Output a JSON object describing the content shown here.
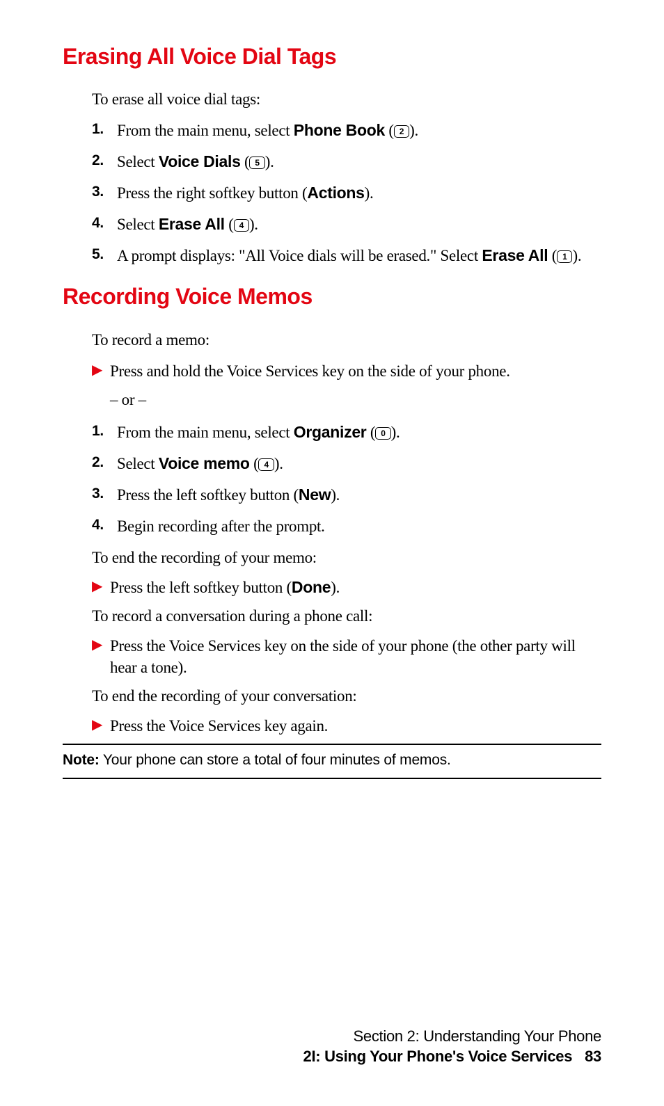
{
  "section1": {
    "heading": "Erasing All Voice Dial Tags",
    "intro": "To erase all voice dial tags:",
    "steps": [
      {
        "num": "1.",
        "pre": "From the main menu, select ",
        "bold": "Phone Book",
        "post_open": " (",
        "key": "2",
        "post_close": ")."
      },
      {
        "num": "2.",
        "pre": "Select ",
        "bold": "Voice Dials",
        "post_open": " (",
        "key": "5",
        "post_close": ")."
      },
      {
        "num": "3.",
        "pre": "Press the right softkey button (",
        "bold": "Actions",
        "post": ")."
      },
      {
        "num": "4.",
        "pre": "Select ",
        "bold": "Erase All",
        "post_open": " (",
        "key": "4",
        "post_close": ")."
      },
      {
        "num": "5.",
        "pre": "A prompt displays: \"All Voice dials will be erased.\" Select ",
        "bold": "Erase All",
        "post_open": " (",
        "key": "1",
        "post_close": ")."
      }
    ]
  },
  "section2": {
    "heading": "Recording Voice Memos",
    "intro": "To record a memo:",
    "bullet1": "Press and hold the Voice Services key on the side of your phone.",
    "ordash": "– or –",
    "steps": [
      {
        "num": "1.",
        "pre": "From the main menu, select ",
        "bold": "Organizer",
        "post_open": " (",
        "key": "0",
        "post_close": ")."
      },
      {
        "num": "2.",
        "pre": "Select ",
        "bold": "Voice memo",
        "post_open": " (",
        "key": "4",
        "post_close": ")."
      },
      {
        "num": "3.",
        "pre": "Press the left softkey button (",
        "bold": "New",
        "post": ")."
      },
      {
        "num": "4.",
        "pre": "Begin recording after the prompt."
      }
    ],
    "para_end_memo": "To end the recording of your memo:",
    "bullet_done_pre": "Press the left softkey button (",
    "bullet_done_bold": "Done",
    "bullet_done_post": ").",
    "para_record_conv": "To record a conversation during a phone call:",
    "bullet_conv": "Press the Voice Services key on the side of your phone (the other party will hear a tone).",
    "para_end_conv": "To end the recording of your conversation:",
    "bullet_again": "Press the Voice Services key again."
  },
  "note": {
    "label": "Note:",
    "text": " Your phone can store a total of four minutes of memos."
  },
  "footer": {
    "line1": "Section 2: Understanding Your Phone",
    "line2": "2I: Using Your Phone's Voice Services",
    "page": "83"
  }
}
